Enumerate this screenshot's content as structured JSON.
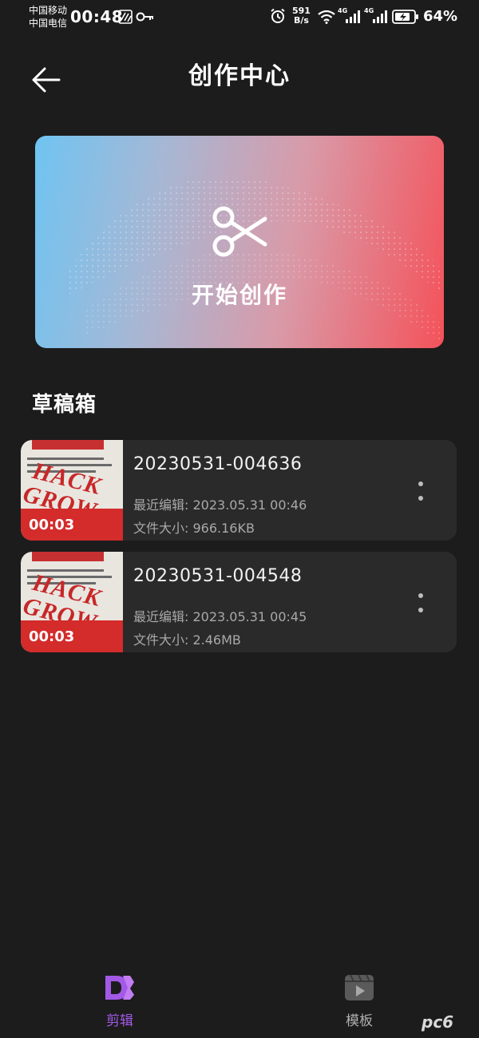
{
  "status_bar": {
    "carrier_1": "中国移动",
    "carrier_2": "中国电信",
    "time": "00:48",
    "net_speed_value": "591",
    "net_speed_unit": "B/s",
    "signal_label_1": "4G",
    "signal_label_2": "4G",
    "battery_percent": "64%",
    "icons": [
      "nfc-icon",
      "key-icon",
      "alarm-icon",
      "wifi-icon",
      "signal-icon",
      "battery-charging-icon"
    ]
  },
  "header": {
    "title": "创作中心",
    "back_icon": "arrow-left-icon"
  },
  "banner": {
    "label": "开始创作",
    "icon": "scissors-icon",
    "colors": {
      "left": "#6fc4f2",
      "right": "#f4525a"
    }
  },
  "drafts_section": {
    "title": "草稿箱",
    "items": [
      {
        "name": "20230531-004636",
        "last_edited": "最近编辑: 2023.05.31 00:46",
        "file_size": "文件大小:  966.16KB",
        "duration": "00:03"
      },
      {
        "name": "20230531-004548",
        "last_edited": "最近编辑: 2023.05.31 00:45",
        "file_size": "文件大小:  2.46MB",
        "duration": "00:03"
      }
    ]
  },
  "bottom_nav": {
    "tabs": [
      {
        "label": "剪辑",
        "icon": "edit-logo-icon",
        "active": true,
        "color": "#a259e6"
      },
      {
        "label": "模板",
        "icon": "template-play-icon",
        "active": false,
        "color": "#b0b0b0"
      }
    ]
  },
  "watermark": {
    "text": "pc6"
  }
}
